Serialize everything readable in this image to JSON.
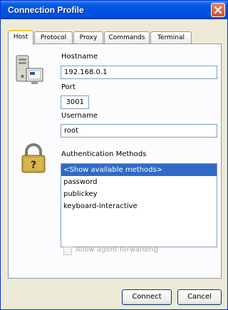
{
  "window": {
    "title": "Connection Profile"
  },
  "tabs": [
    {
      "label": "Host",
      "active": true
    },
    {
      "label": "Protocol",
      "active": false
    },
    {
      "label": "Proxy",
      "active": false
    },
    {
      "label": "Commands",
      "active": false
    },
    {
      "label": "Terminal",
      "active": false
    }
  ],
  "host": {
    "hostname_label": "Hostname",
    "hostname_value": "192.168.0.1",
    "port_label": "Port",
    "port_value": "3001",
    "username_label": "Username",
    "username_value": "root"
  },
  "auth": {
    "label": "Authentication Methods",
    "methods": [
      "<Show available methods>",
      "password",
      "publickey",
      "keyboard-interactive"
    ],
    "selected_index": 0
  },
  "agent_forwarding": {
    "label": "Allow agent forwarding",
    "checked": false,
    "enabled": false
  },
  "buttons": {
    "connect": "Connect",
    "cancel": "Cancel"
  },
  "colors": {
    "titlebar": "#0054e3",
    "selection": "#316ac5",
    "tab_highlight": "#ffc83c"
  },
  "icons": {
    "host": "computer-icon",
    "auth": "padlock-icon",
    "close": "close-icon"
  }
}
